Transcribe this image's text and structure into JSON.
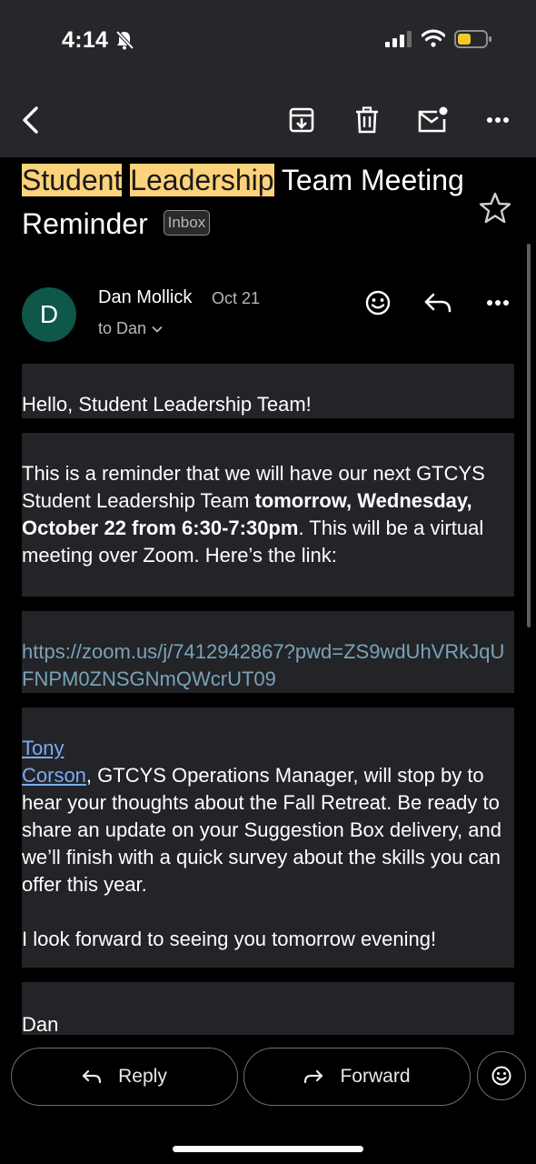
{
  "status_bar": {
    "time": "4:14"
  },
  "subject": {
    "word1": "Student",
    "word2": "Leadership",
    "rest": "Team Meeting Reminder",
    "label": "Inbox"
  },
  "sender": {
    "initial": "D",
    "name": "Dan Mollick",
    "date": "Oct 21",
    "to": "to Dan"
  },
  "body": {
    "greeting": "Hello, Student Leadership Team!",
    "para1_start": "This is a reminder that we will have our next GTCYS Student Leadership Team ",
    "para1_bold": "tomorrow, Wednesday, October 22 from 6:30-7:30pm",
    "para1_end": ". This will be a virtual meeting over Zoom. Here’s the link:",
    "zoom_link": "https://zoom.us/j/7412942867?pwd=ZS9wdUhVRkJqUFNPM0ZNSGNmQWcrUT09",
    "link_first": "Tony",
    "link_second": " Corson",
    "para2": ", GTCYS Operations Manager, will stop by to hear your thoughts about the Fall Retreat. Be ready to share an update on your Suggestion Box delivery, and we’ll finish with a quick survey about the skills you can offer this year.",
    "para3": "I look forward to seeing you tomorrow evening!",
    "signature": "Dan"
  },
  "actions": {
    "reply_label": "Reply",
    "forward_label": "Forward"
  },
  "colors": {
    "highlight": "#fcd27a",
    "avatar_bg": "#0f5748",
    "toolbar_bg": "#26272a",
    "block_bg": "#232428"
  },
  "icons": [
    "back-arrow-icon",
    "archive-icon",
    "trash-icon",
    "mark-unread-icon",
    "more-icon",
    "star-icon",
    "emoji-icon",
    "reply-icon",
    "forward-icon",
    "chevron-down-icon"
  ]
}
